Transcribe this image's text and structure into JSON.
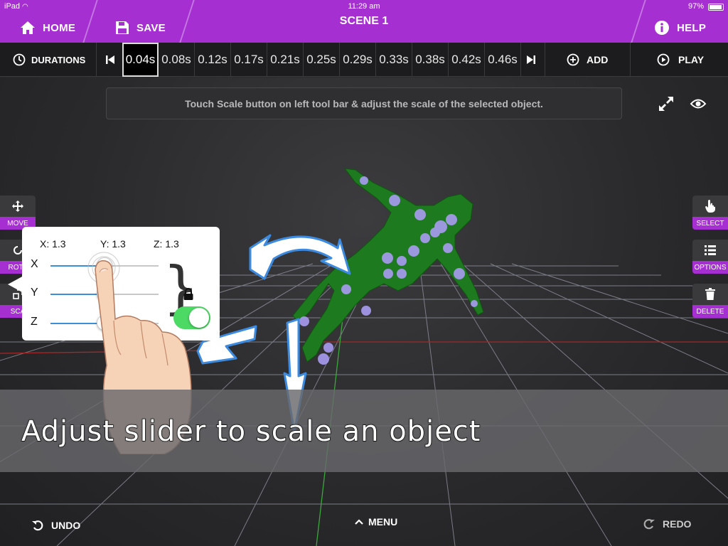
{
  "status_bar": {
    "device": "iPad",
    "time": "11:29 am",
    "battery": "97%"
  },
  "header": {
    "home_label": "HOME",
    "save_label": "SAVE",
    "scene_title": "SCENE 1",
    "help_label": "HELP"
  },
  "timeline": {
    "durations_label": "DURATIONS",
    "frames": [
      "0.04s",
      "0.08s",
      "0.12s",
      "0.17s",
      "0.21s",
      "0.25s",
      "0.29s",
      "0.33s",
      "0.38s",
      "0.42s",
      "0.46s"
    ],
    "active_frame": "0.04s",
    "add_label": "ADD",
    "play_label": "PLAY"
  },
  "viewport": {
    "instruction": "Touch Scale button on left tool bar & adjust the scale of the selected object."
  },
  "left_tools": {
    "move": "MOVE",
    "rotate": "ROTA",
    "scale": "SCA"
  },
  "right_tools": {
    "select": "SELECT",
    "options": "OPTIONS",
    "delete": "DELETE"
  },
  "scale_popup": {
    "x_value": "X:  1.3",
    "y_value": "Y:  1.3",
    "z_value": "Z:  1.3",
    "x_axis": "X",
    "y_axis": "Y",
    "z_axis": "Z",
    "sliders": {
      "x": 0.5,
      "y": 0.5,
      "z": 0.5
    },
    "lock_enabled": true
  },
  "caption": "Adjust slider to scale an object",
  "bottom_bar": {
    "undo_label": "UNDO",
    "menu_label": "MENU",
    "redo_label": "REDO"
  },
  "colors": {
    "accent": "#a62fd2",
    "toggle_on": "#4cd964",
    "figure": "#1e7a1e",
    "joint": "#a99cf2"
  }
}
